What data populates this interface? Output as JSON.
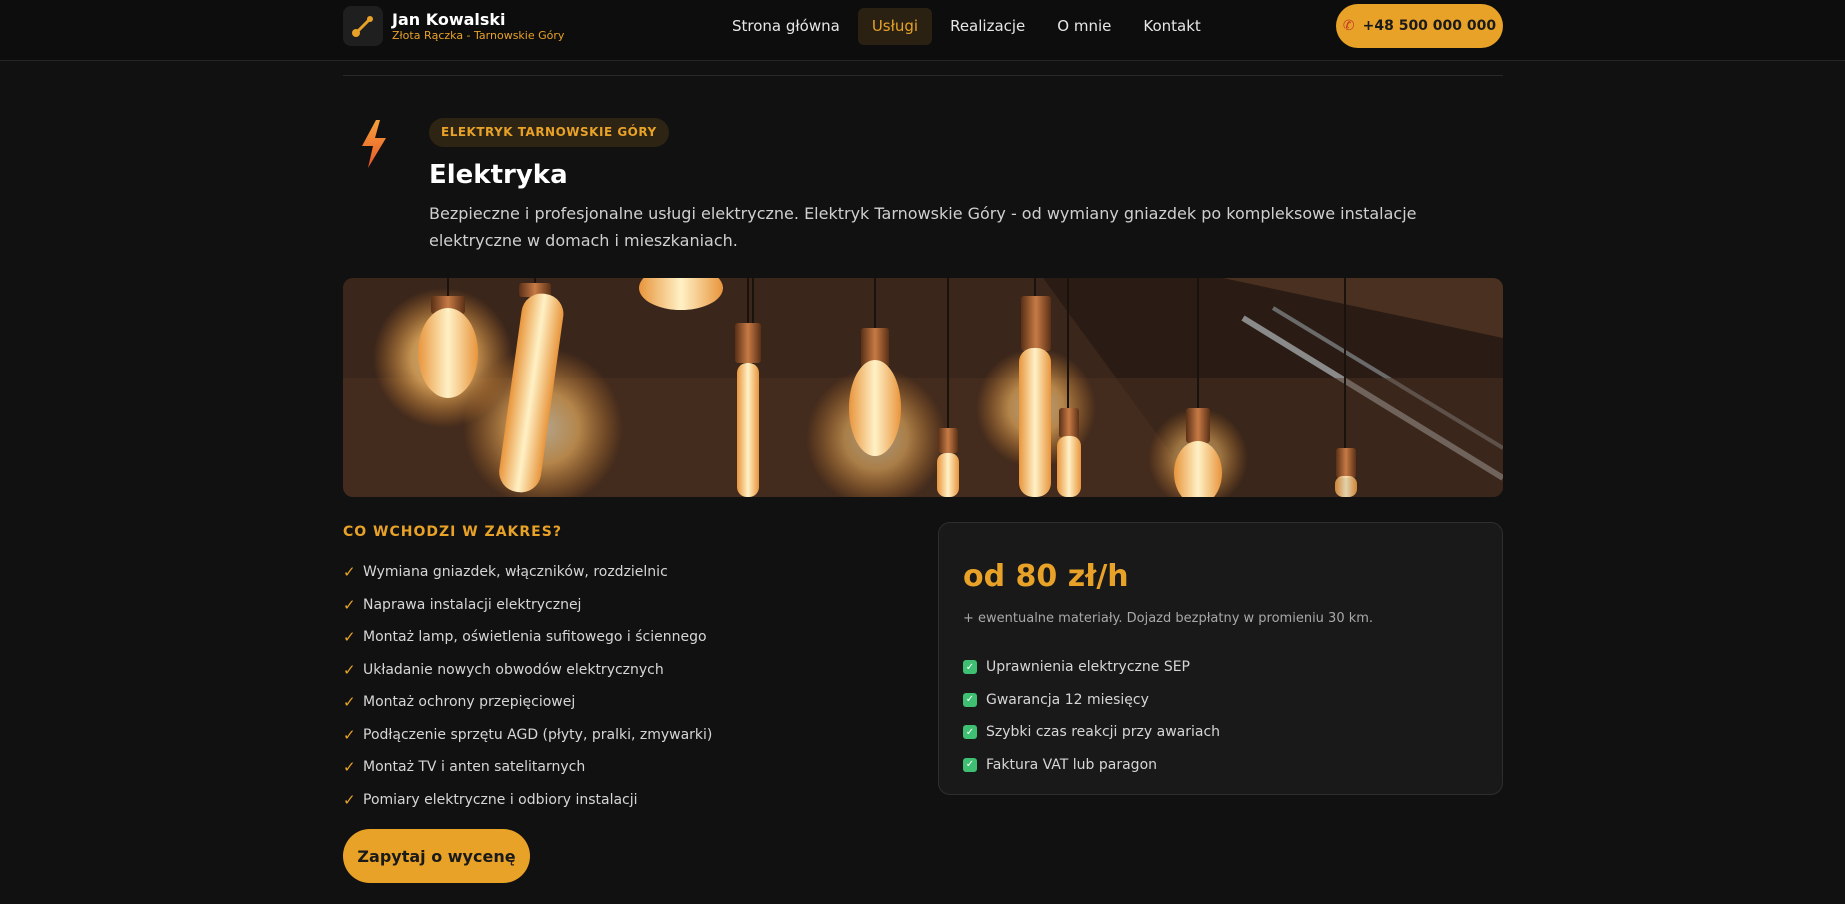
{
  "header": {
    "brand_name": "Jan Kowalski",
    "brand_sub": "Złota Rączka - Tarnowskie Góry",
    "nav": [
      {
        "label": "Strona główna"
      },
      {
        "label": "Usługi"
      },
      {
        "label": "Realizacje"
      },
      {
        "label": "O mnie"
      },
      {
        "label": "Kontakt"
      }
    ],
    "active_nav": "Usługi",
    "phone_label": "+48 500 000 000"
  },
  "service": {
    "badge": "ELEKTRYK TARNOWSKIE GÓRY",
    "title": "Elektryka",
    "description": "Bezpieczne i profesjonalne usługi elektryczne. Elektryk Tarnowskie Góry - od wymiany gniazdek po kompleksowe instalacje elektryczne w domach i mieszkaniach."
  },
  "scope": {
    "title": "CO WCHODZI W ZAKRES?",
    "items": [
      "Wymiana gniazdek, włączników, rozdzielnic",
      "Naprawa instalacji elektrycznej",
      "Montaż lamp, oświetlenia sufitowego i ściennego",
      "Układanie nowych obwodów elektrycznych",
      "Montaż ochrony przepięciowej",
      "Podłączenie sprzętu AGD (płyty, pralki, zmywarki)",
      "Montaż TV i anten satelitarnych",
      "Pomiary elektryczne i odbiory instalacji"
    ]
  },
  "cta_label": "Zapytaj o wycenę",
  "price_card": {
    "price": "od 80 zł/h",
    "note": "+ ewentualne materiały. Dojazd bezpłatny w promieniu 30 km.",
    "features": [
      "Uprawnienia elektryczne SEP",
      "Gwarancja 12 miesięcy",
      "Szybki czas reakcji przy awariach",
      "Faktura VAT lub paragon"
    ]
  },
  "colors": {
    "accent": "#e8a227",
    "background": "#111111",
    "check_green": "#3fbf72"
  },
  "icons": {
    "logo": "wrench-icon",
    "phone": "phone-icon",
    "service": "lightning-bolt-icon",
    "scope_check": "checkmark-icon",
    "feature_check": "checkbox-checked-icon"
  }
}
